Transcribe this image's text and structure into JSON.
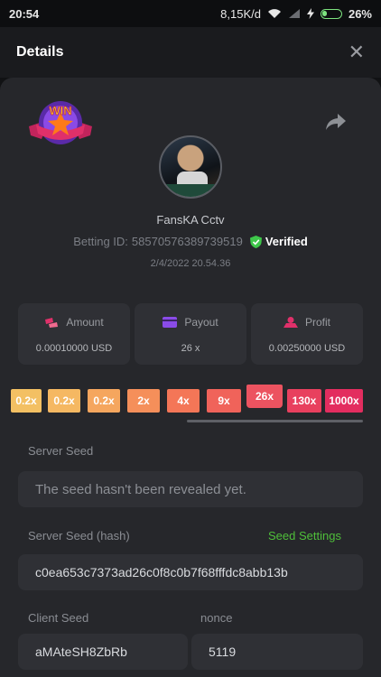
{
  "status_bar": {
    "time": "20:54",
    "speed": "8,15K/d",
    "battery": "26%",
    "battery_level": 0.26,
    "icons": [
      "wifi-icon",
      "signal-icon",
      "charging-icon",
      "battery-icon"
    ]
  },
  "header": {
    "title": "Details",
    "close_icon": "close-icon"
  },
  "badge": {
    "text": "WIN",
    "colors": {
      "ribbon": "#e0306a",
      "ring": "#7a3fd1",
      "star": "#ff7a1a",
      "text": "#ffd21f"
    }
  },
  "user": {
    "name": "FansKA Cctv",
    "betting_id_label": "Betting ID:",
    "betting_id": "58570576389739519",
    "verified_label": "Verified",
    "date": "2/4/2022 20.54.36"
  },
  "stats": [
    {
      "label": "Amount",
      "value": "0.00010000 USD",
      "icon": "amount-icon",
      "color": "#e0306a"
    },
    {
      "label": "Payout",
      "value": "26 x",
      "icon": "payout-icon",
      "color": "#8a4be8"
    },
    {
      "label": "Profit",
      "value": "0.00250000 USD",
      "icon": "profit-icon",
      "color": "#e0306a"
    }
  ],
  "multipliers": [
    {
      "label": "0.2x",
      "color": "#f3c063"
    },
    {
      "label": "0.2x",
      "color": "#f5b862"
    },
    {
      "label": "0.2x",
      "color": "#f5a65e"
    },
    {
      "label": "2x",
      "color": "#f58f5a"
    },
    {
      "label": "4x",
      "color": "#f47657"
    },
    {
      "label": "9x",
      "color": "#f0635a"
    },
    {
      "label": "26x",
      "color": "#ec5360",
      "active": true
    },
    {
      "label": "130x",
      "color": "#e8405e"
    },
    {
      "label": "1000x",
      "color": "#e32d5f"
    }
  ],
  "server_seed": {
    "label": "Server Seed",
    "value": "The seed hasn't been revealed yet."
  },
  "server_seed_hash": {
    "label": "Server Seed (hash)",
    "settings_link": "Seed Settings",
    "value": "c0ea653c7373ad26c0f8c0b7f68fffdc8abb13b"
  },
  "client_seed": {
    "label": "Client Seed",
    "value": "aMAteSH8ZbRb"
  },
  "nonce": {
    "label": "nonce",
    "value": "5119"
  }
}
